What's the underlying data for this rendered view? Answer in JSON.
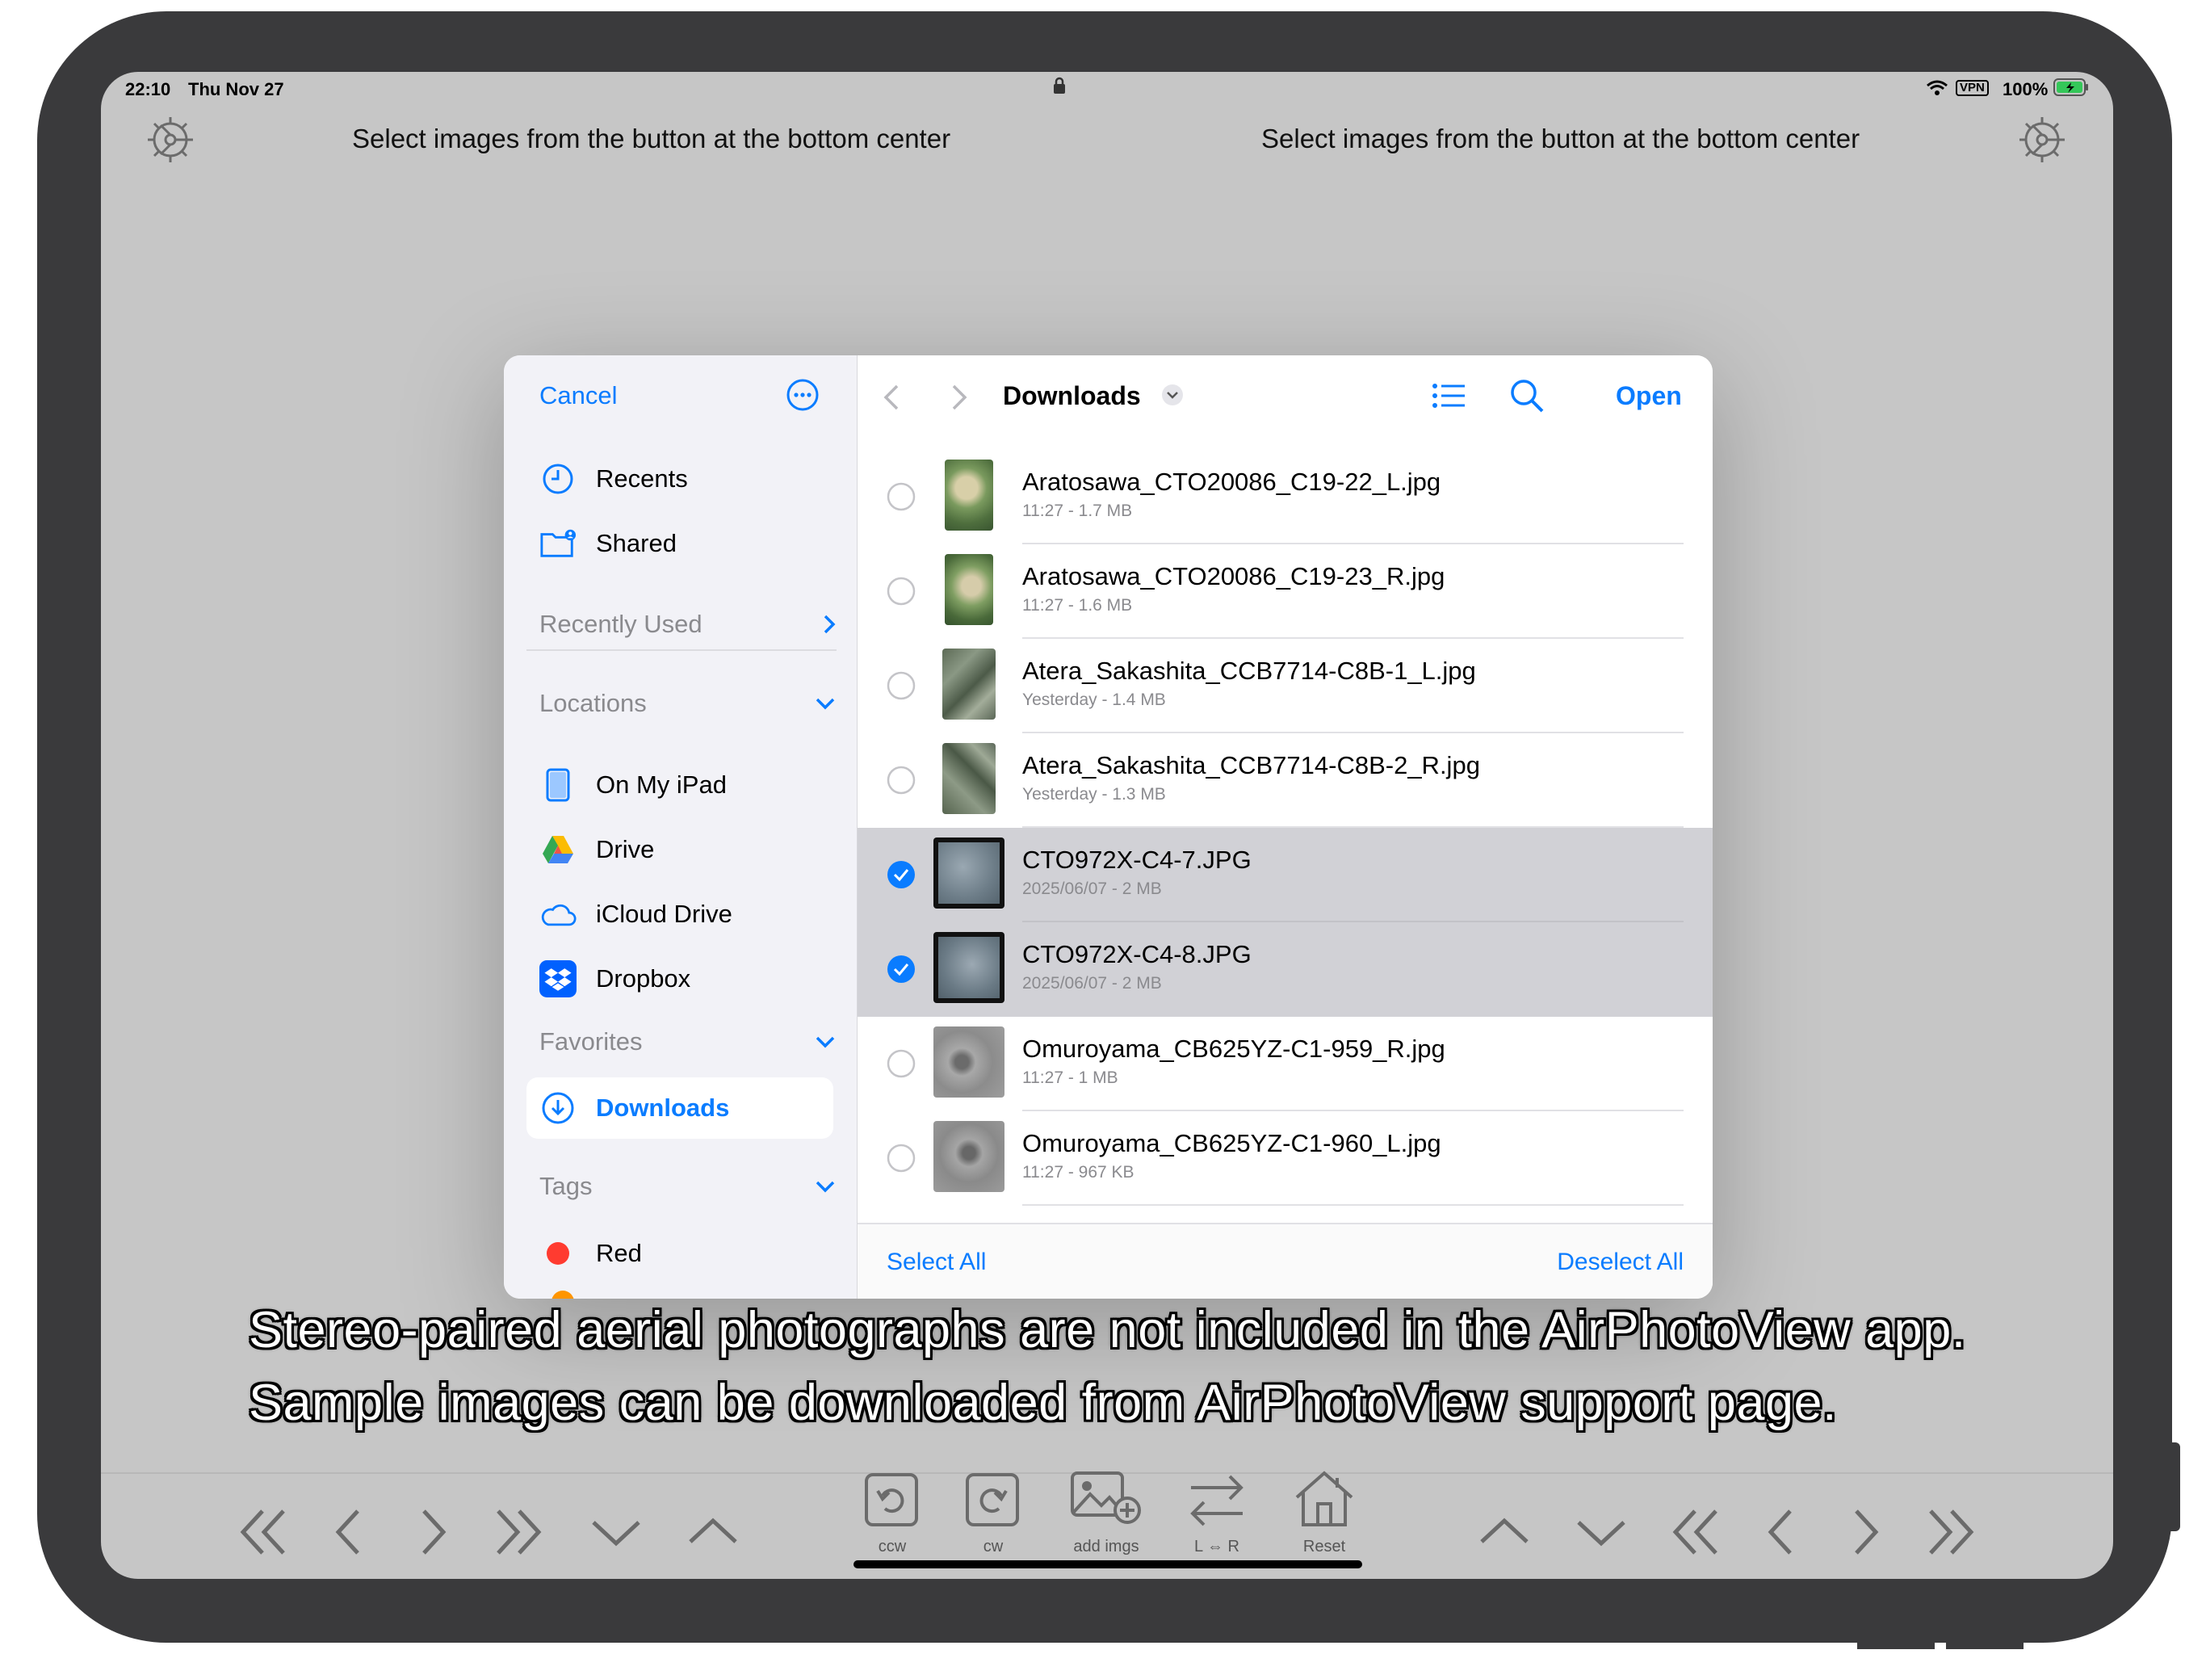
{
  "status_bar": {
    "time": "22:10",
    "date": "Thu Nov 27",
    "vpn": "VPN",
    "battery": "100%"
  },
  "header": {
    "left_hint": "Select images from the button at the bottom center",
    "right_hint": "Select images from the button at the bottom center"
  },
  "picker": {
    "cancel_label": "Cancel",
    "sidebar": {
      "recents": "Recents",
      "shared": "Shared",
      "recently_used": "Recently Used",
      "locations_title": "Locations",
      "locations": [
        "On My iPad",
        "Drive",
        "iCloud Drive",
        "Dropbox"
      ],
      "favorites_title": "Favorites",
      "favorites": [
        "Downloads"
      ],
      "tags_title": "Tags",
      "tags": [
        {
          "name": "Red",
          "color": "#ff3b30"
        }
      ]
    },
    "toolbar": {
      "folder_title": "Downloads",
      "open_label": "Open"
    },
    "files": [
      {
        "name": "Aratosawa_CTO20086_C19-22_L.jpg",
        "meta": "11:27 - 1.7 MB",
        "selected": false
      },
      {
        "name": "Aratosawa_CTO20086_C19-23_R.jpg",
        "meta": "11:27 - 1.6 MB",
        "selected": false
      },
      {
        "name": "Atera_Sakashita_CCB7714-C8B-1_L.jpg",
        "meta": "Yesterday - 1.4 MB",
        "selected": false
      },
      {
        "name": "Atera_Sakashita_CCB7714-C8B-2_R.jpg",
        "meta": "Yesterday - 1.3 MB",
        "selected": false
      },
      {
        "name": "CTO972X-C4-7.JPG",
        "meta": "2025/06/07 - 2 MB",
        "selected": true
      },
      {
        "name": "CTO972X-C4-8.JPG",
        "meta": "2025/06/07 - 2 MB",
        "selected": true
      },
      {
        "name": "Omuroyama_CB625YZ-C1-959_R.jpg",
        "meta": "11:27 - 1 MB",
        "selected": false
      },
      {
        "name": "Omuroyama_CB625YZ-C1-960_L.jpg",
        "meta": "11:27 - 967 KB",
        "selected": false
      }
    ],
    "select_all": "Select All",
    "deselect_all": "Deselect All"
  },
  "caption": {
    "line1": "Stereo-paired aerial photographs are not included in the AirPhotoView app.",
    "line2": "Sample images can be downloaded from AirPhotoView support page."
  },
  "tools": {
    "ccw": "ccw",
    "cw": "cw",
    "add": "add imgs",
    "swap": "L ⇔ R",
    "reset": "Reset"
  },
  "colors": {
    "accent": "#0a7cff",
    "selected_row": "#d1d1d6",
    "screen_bg": "#c6c6c6"
  }
}
